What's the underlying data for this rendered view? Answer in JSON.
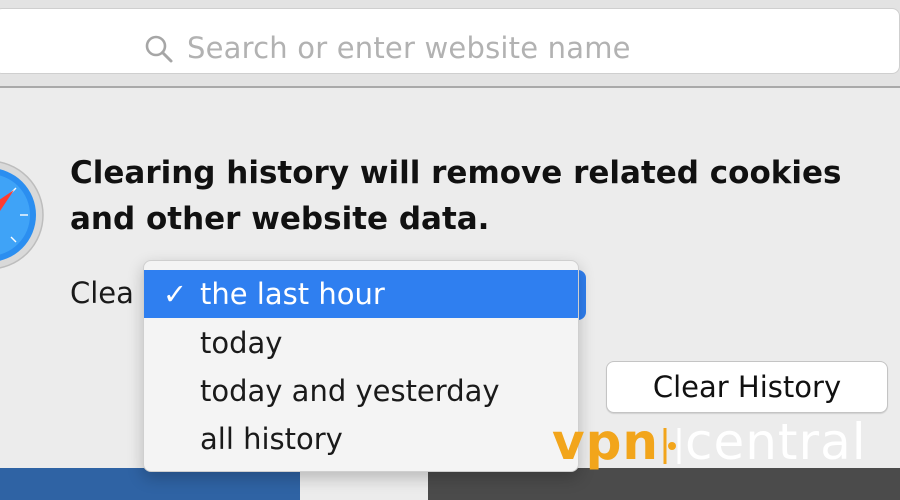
{
  "address_bar": {
    "placeholder": "Search or enter website name",
    "icon": "search-icon"
  },
  "dialog": {
    "message": "Clearing history will remove related cookies and other website data.",
    "clear_label": "Clea",
    "clear_history_button": "Clear History",
    "app_icon": "safari-compass-icon"
  },
  "dropdown": {
    "selected_index": 0,
    "checkmark": "✓",
    "options": [
      {
        "label": "the last hour"
      },
      {
        "label": "today"
      },
      {
        "label": "today and yesterday"
      },
      {
        "label": "all history"
      }
    ]
  },
  "watermark": {
    "part1": "vpn",
    "part2": "central",
    "vpn_color": "#f2a51b",
    "central_color": "#ffffff"
  },
  "colors": {
    "selection": "#2f7ff0",
    "background": "#ececec",
    "bottom_left": "#2f63a4",
    "bottom_right": "#4b4b4b"
  }
}
